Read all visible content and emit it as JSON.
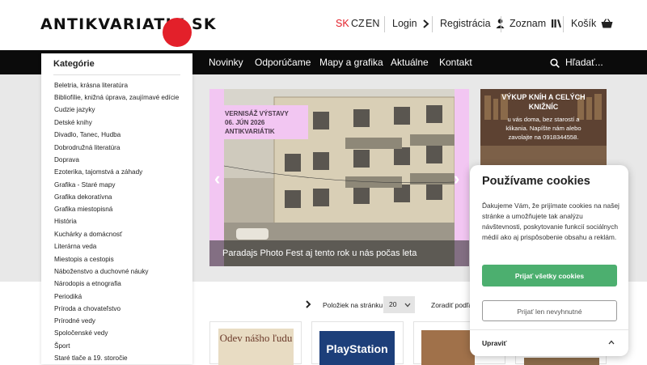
{
  "header": {
    "logo_text": "ANTIKVARIATIK",
    "logo_suffix": "SK",
    "languages": [
      "SK",
      "CZ",
      "EN"
    ],
    "login": "Login",
    "register": "Registrácia",
    "wishlist": "Zoznam",
    "cart": "Košík"
  },
  "nav": {
    "items": [
      "Novinky",
      "Odporúčame",
      "Mapy a grafika",
      "Aktuálne",
      "Kontakt"
    ],
    "search_placeholder": "Hľadať..."
  },
  "sidebar": {
    "title": "Kategórie",
    "items": [
      "Beletria, krásna literatúra",
      "Bibliofílie, knižná úprava, zaujímavé edície",
      "Cudzie jazyky",
      "Detské knihy",
      "Divadlo, Tanec, Hudba",
      "Dobrodružná literatúra",
      "Doprava",
      "Ezoterika, tajomstvá a záhady",
      "Grafika - Staré mapy",
      "Grafika dekoratívna",
      "Grafika miestopisná",
      "História",
      "Kuchárky a domácnosť",
      "Literárna veda",
      "Miestopis a cestopis",
      "Náboženstvo a duchovné náuky",
      "Národopis a etnografia",
      "Periodiká",
      "Príroda a chovateľstvo",
      "Prírodné vedy",
      "Spoločenské vedy",
      "Šport",
      "Staré tlače a 19. storočie"
    ]
  },
  "banner": {
    "tag_lines": [
      "VERNISÁŽ VÝSTAVY",
      "06. JÚN 2026",
      "ANTIKVARIÁTIK"
    ],
    "caption": "Paradajs Photo Fest aj tento rok u nás počas leta"
  },
  "side_banner": {
    "title_lines": [
      "VÝKUP KNÍH A CELÝCH",
      "KNIŽNÍC"
    ],
    "text_lines": [
      "u vás doma, bez starostí a",
      "klikania. Napíšte nám alebo",
      "zavolajte na 0918344558."
    ]
  },
  "toolbar": {
    "per_page_label": "Položiek na stránku",
    "per_page_value": "20",
    "sort_label": "Zoradiť podľa"
  },
  "products": {
    "covers": [
      "Odev nášho ľudu",
      "PlayStation"
    ]
  },
  "cookie": {
    "title": "Používame cookies",
    "text": "Ďakujeme Vám, že prijímate cookies na našej stránke a umožňujete tak analýzu návštevnosti, poskytovanie funkcií sociálnych médií ako aj prispôsobenie obsahu a reklám.",
    "accept_all": "Prijať všetky cookies",
    "accept_necessary": "Prijať len nevyhnutné",
    "customize": "Upraviť"
  },
  "colors": {
    "accent_red": "#e3202a",
    "navbar": "#0b0b0b",
    "accept_green": "#4caf6f",
    "banner_pink": "#f2c6f2"
  }
}
